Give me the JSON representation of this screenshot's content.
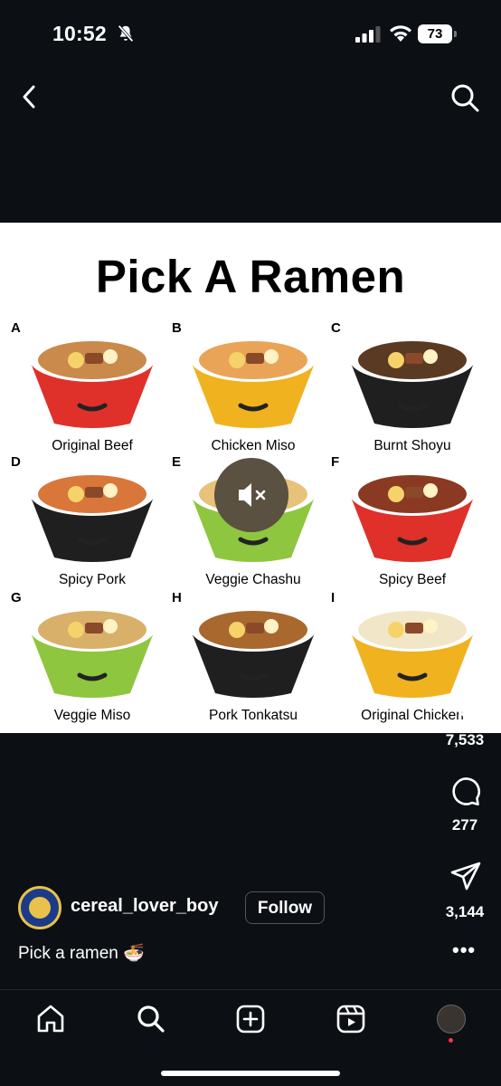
{
  "status": {
    "time": "10:52",
    "battery": "73",
    "icons": [
      "bell-off-icon",
      "signal-icon",
      "wifi-icon",
      "battery-icon"
    ]
  },
  "topbar": {
    "icons": [
      "back-chevron-icon",
      "search-icon"
    ]
  },
  "post": {
    "title": "Pick A Ramen",
    "options": [
      {
        "letter": "A",
        "label": "Original Beef",
        "bowl_color": "#e0302a",
        "broth": "#c98a4b"
      },
      {
        "letter": "B",
        "label": "Chicken Miso",
        "bowl_color": "#f0b21e",
        "broth": "#e9a457"
      },
      {
        "letter": "C",
        "label": "Burnt Shoyu",
        "bowl_color": "#1f1f1f",
        "broth": "#5a3a22"
      },
      {
        "letter": "D",
        "label": "Spicy Pork",
        "bowl_color": "#1f1f1f",
        "broth": "#d9763a"
      },
      {
        "letter": "E",
        "label": "Veggie Chashu",
        "bowl_color": "#8ec63f",
        "broth": "#e7c27a"
      },
      {
        "letter": "F",
        "label": "Spicy Beef",
        "bowl_color": "#e0302a",
        "broth": "#8a3a22"
      },
      {
        "letter": "G",
        "label": "Veggie Miso",
        "bowl_color": "#8ec63f",
        "broth": "#d9b06a"
      },
      {
        "letter": "H",
        "label": "Pork Tonkatsu",
        "bowl_color": "#1f1f1f",
        "broth": "#a8682e"
      },
      {
        "letter": "I",
        "label": "Original Chicken",
        "bowl_color": "#f0b21e",
        "broth": "#f2e6c8"
      }
    ],
    "mute_icon": "speaker-muted-icon"
  },
  "actions": {
    "likes": "7,533",
    "comments": "277",
    "shares": "3,144"
  },
  "author": {
    "username": "cereal_lover_boy",
    "follow_label": "Follow",
    "caption": "Pick a ramen 🍜"
  },
  "bottom_nav": {
    "icons": [
      "home-icon",
      "search-icon",
      "create-icon",
      "reels-icon",
      "profile-avatar"
    ]
  }
}
